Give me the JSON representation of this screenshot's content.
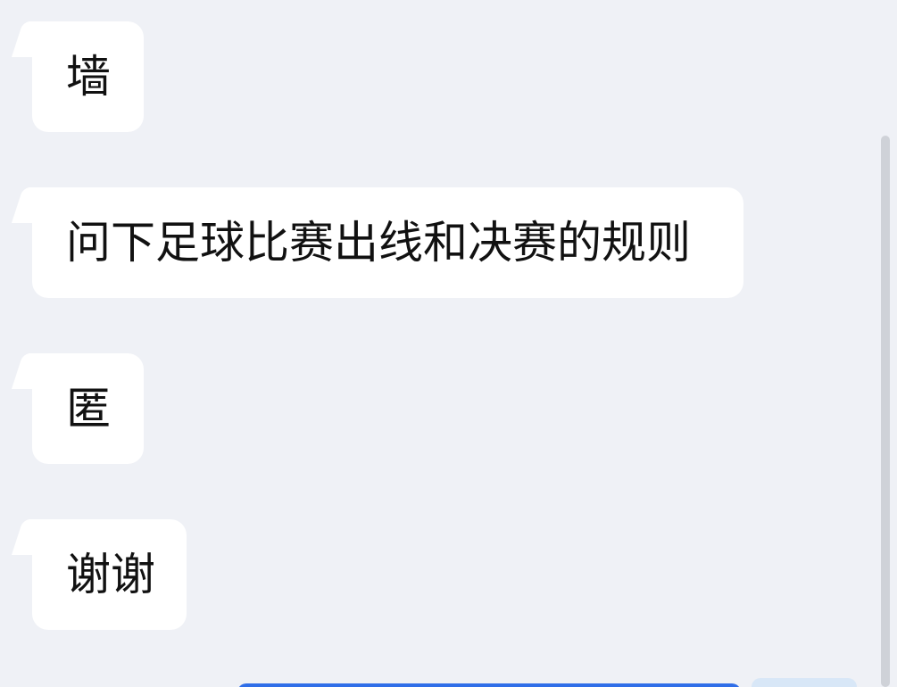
{
  "messages": [
    {
      "text": "墙"
    },
    {
      "text": "问下足球比赛出线和决赛的规则"
    },
    {
      "text": "匿"
    },
    {
      "text": "谢谢"
    }
  ],
  "colors": {
    "background": "#eff1f6",
    "bubble": "#ffffff",
    "text": "#111111",
    "outgoing_bubble": "#2f6ee8",
    "scrollbar": "#cfd2d8"
  }
}
